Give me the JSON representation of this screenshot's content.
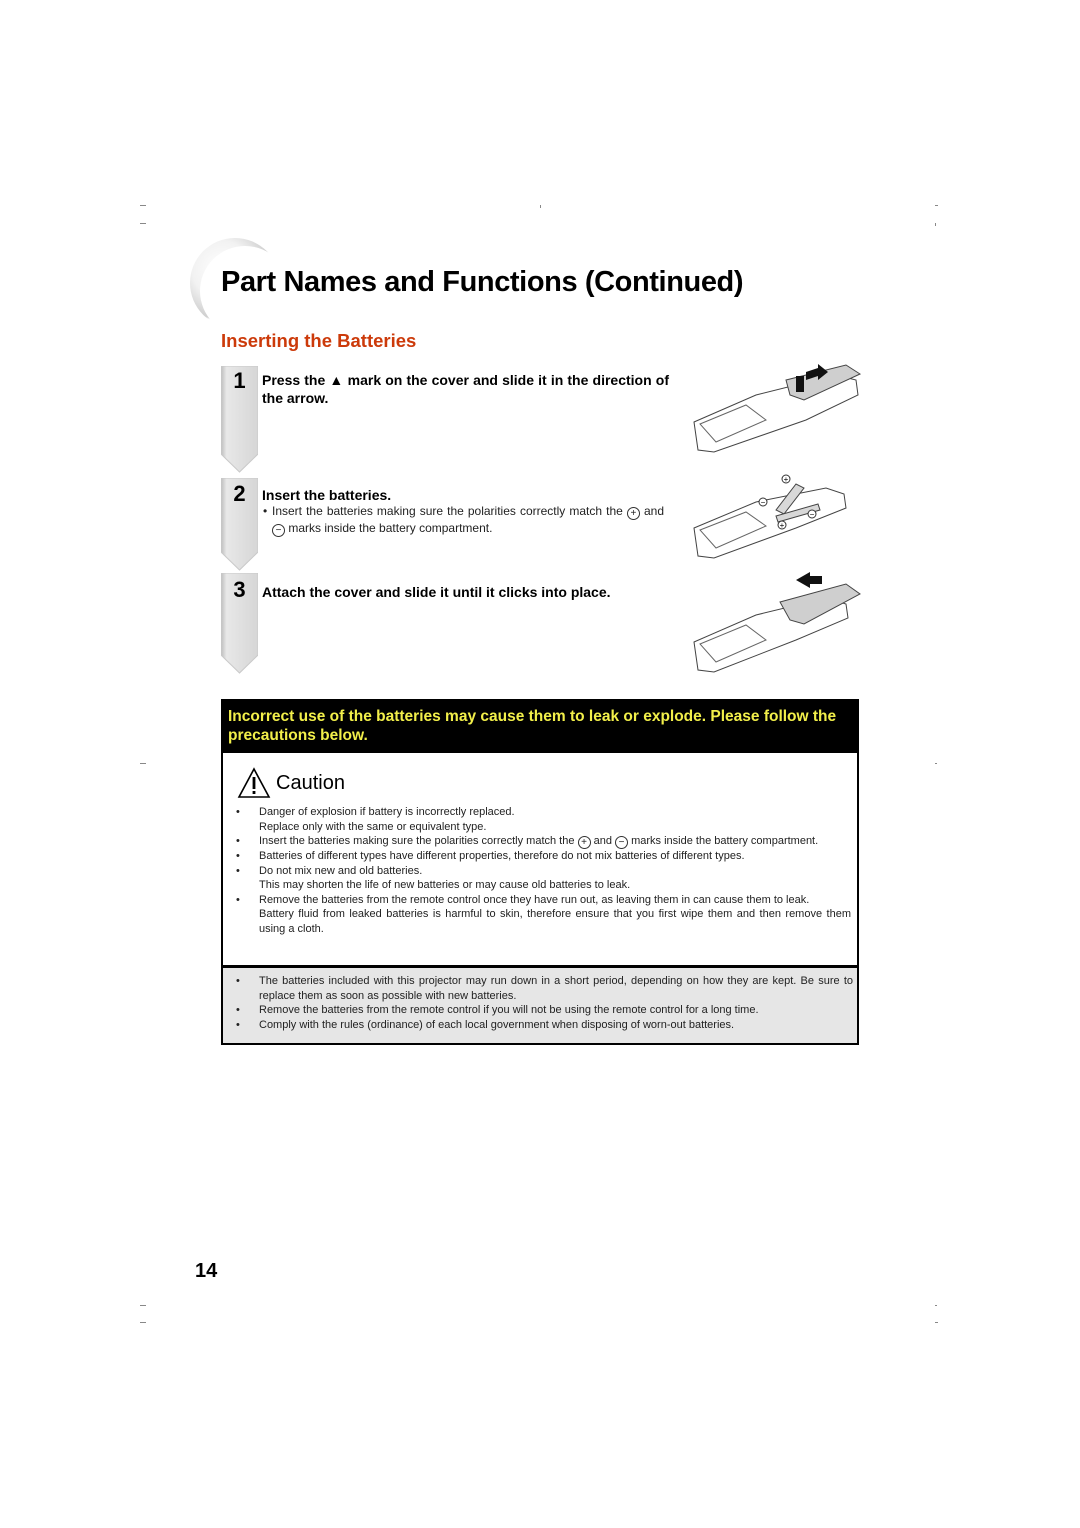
{
  "page": {
    "title": "Part Names and Functions (Continued)",
    "section_title": "Inserting the Batteries",
    "page_number": "14"
  },
  "steps": [
    {
      "number": "1",
      "text": "Press the ▲ mark on the cover and slide it in the direction of the arrow.",
      "illustration": "remote-cover-slide-open"
    },
    {
      "number": "2",
      "text": "Insert the batteries.",
      "sub_before": "Insert the batteries making sure the polarities correctly match the",
      "sub_and": "and",
      "sub_after": "marks inside the battery compartment.",
      "illustration": "remote-insert-batteries"
    },
    {
      "number": "3",
      "text": "Attach the cover and slide it until it clicks into place.",
      "illustration": "remote-cover-slide-closed"
    }
  ],
  "symbols": {
    "plus": "+",
    "minus": "−",
    "bullet": "•"
  },
  "warning": {
    "banner": "Incorrect use of the batteries may cause them to leak or explode. Please follow the precautions below.",
    "caution_label": "Caution",
    "banner_text_color": "#f2ef4a",
    "items": [
      {
        "lines": [
          "Danger of explosion if battery is incorrectly replaced.",
          "Replace only with the same or equivalent type."
        ]
      },
      {
        "before": "Insert the batteries making sure the polarities correctly match the",
        "and": "and",
        "after": "marks inside the battery compartment."
      },
      {
        "lines": [
          "Batteries of different types have different properties, therefore do not mix batteries of different types."
        ]
      },
      {
        "lines": [
          "Do not mix new and old batteries.",
          "This may shorten the life of new batteries or may cause old batteries to leak."
        ]
      },
      {
        "lines": [
          "Remove the batteries from the remote control once they have run out, as leaving them in can cause them to leak.",
          "Battery fluid from leaked batteries is harmful to skin, therefore ensure that you first wipe them and then remove them using a cloth."
        ]
      }
    ]
  },
  "notes": [
    "The batteries included with this projector may run down in a short period, depending on how they are kept. Be sure to replace them as soon as possible with new batteries.",
    "Remove the batteries from the remote control if you will not be using the remote control for a long time.",
    "Comply with the rules (ordinance) of each local government when disposing of worn-out batteries."
  ],
  "colors": {
    "section_title": "#cc3a0a",
    "banner_bg": "#000000",
    "note_bg": "#e6e6e6"
  }
}
